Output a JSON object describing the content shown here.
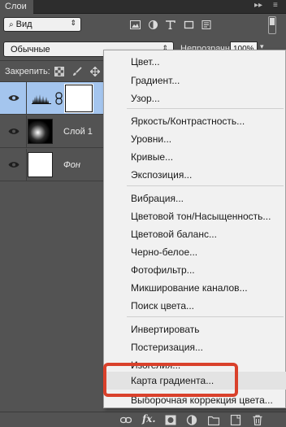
{
  "panel": {
    "tab_title": "Слои"
  },
  "filter": {
    "kind_value": "Вид"
  },
  "blend": {
    "mode_value": "Обычные",
    "opacity_label": "Непрозрачность:",
    "opacity_value": "100%"
  },
  "lock": {
    "label": "Закрепить:"
  },
  "layers": [
    {
      "name": "",
      "type": "adjustment",
      "selected": true
    },
    {
      "name": "Слой 1",
      "type": "pixel",
      "selected": false
    },
    {
      "name": "Фон",
      "type": "background",
      "selected": false
    }
  ],
  "menu": {
    "items": [
      "Цвет...",
      "Градиент...",
      "Узор...",
      "Яркость/Контрастность...",
      "Уровни...",
      "Кривые...",
      "Экспозиция...",
      "Вибрация...",
      "Цветовой тон/Насыщенность...",
      "Цветовой баланс...",
      "Черно-белое...",
      "Фотофильтр...",
      "Микширование каналов...",
      "Поиск цвета...",
      "Инвертировать",
      "Постеризация...",
      "Изогелия...",
      "Карта градиента...",
      "Выборочная коррекция цвета..."
    ],
    "hovered_item": "Карта градиента..."
  },
  "colors": {
    "panel_bg": "#535353",
    "selection": "#a4c5ee",
    "menu_bg": "#f1f1f1",
    "highlight_red": "#d9412b"
  },
  "icons": {
    "filter_icons": [
      "image-icon",
      "adjustment-circle-icon",
      "text-icon",
      "shape-icon",
      "smart-object-icon"
    ],
    "lock_icons": [
      "lock-transparency-icon",
      "lock-brush-icon",
      "lock-move-icon"
    ],
    "bottom_icons": [
      "link-layers-icon",
      "fx-icon",
      "add-mask-icon",
      "new-adjustment-layer-icon",
      "new-group-icon",
      "new-layer-icon",
      "trash-icon"
    ]
  }
}
